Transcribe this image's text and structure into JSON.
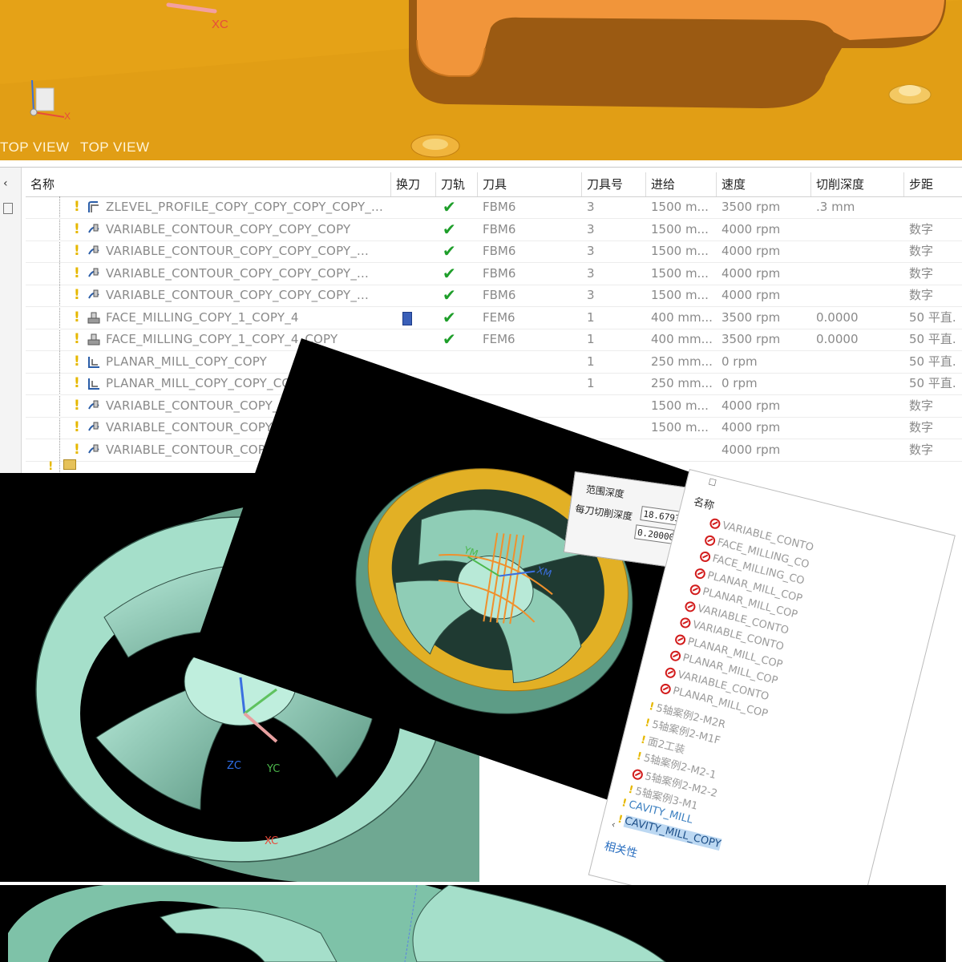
{
  "top_view": {
    "view_labels": [
      "TOP VIEW",
      "TOP VIEW"
    ],
    "axis_xc": "XC",
    "axis_x": "X"
  },
  "operation_table": {
    "columns": [
      "名称",
      "换刀",
      "刀轨",
      "刀具",
      "刀具号",
      "进给",
      "速度",
      "切削深度",
      "步距"
    ],
    "rows": [
      {
        "name": "ZLEVEL_PROFILE_COPY_COPY_COPY_COPY_...",
        "icon": "zlevel-profile-icon",
        "toolchange": false,
        "path_ok": true,
        "tool": "FBM6",
        "tool_no": "3",
        "feed": "1500 m...",
        "speed": "3500 rpm",
        "depth": ".3 mm",
        "step": ""
      },
      {
        "name": "VARIABLE_CONTOUR_COPY_COPY_COPY",
        "icon": "variable-contour-icon",
        "toolchange": false,
        "path_ok": true,
        "tool": "FBM6",
        "tool_no": "3",
        "feed": "1500 m...",
        "speed": "4000 rpm",
        "depth": "",
        "step": "数字"
      },
      {
        "name": "VARIABLE_CONTOUR_COPY_COPY_COPY_...",
        "icon": "variable-contour-icon",
        "toolchange": false,
        "path_ok": true,
        "tool": "FBM6",
        "tool_no": "3",
        "feed": "1500 m...",
        "speed": "4000 rpm",
        "depth": "",
        "step": "数字"
      },
      {
        "name": "VARIABLE_CONTOUR_COPY_COPY_COPY_...",
        "icon": "variable-contour-icon",
        "toolchange": false,
        "path_ok": true,
        "tool": "FBM6",
        "tool_no": "3",
        "feed": "1500 m...",
        "speed": "4000 rpm",
        "depth": "",
        "step": "数字"
      },
      {
        "name": "VARIABLE_CONTOUR_COPY_COPY_COPY_...",
        "icon": "variable-contour-icon",
        "toolchange": false,
        "path_ok": true,
        "tool": "FBM6",
        "tool_no": "3",
        "feed": "1500 m...",
        "speed": "4000 rpm",
        "depth": "",
        "step": "数字"
      },
      {
        "name": "FACE_MILLING_COPY_1_COPY_4",
        "icon": "face-milling-icon",
        "toolchange": true,
        "path_ok": true,
        "tool": "FEM6",
        "tool_no": "1",
        "feed": "400 mm...",
        "speed": "3500 rpm",
        "depth": "0.0000",
        "step": "50 平直."
      },
      {
        "name": "FACE_MILLING_COPY_1_COPY_4_COPY",
        "icon": "face-milling-icon",
        "toolchange": false,
        "path_ok": true,
        "tool": "FEM6",
        "tool_no": "1",
        "feed": "400 mm...",
        "speed": "3500 rpm",
        "depth": "0.0000",
        "step": "50 平直."
      },
      {
        "name": "PLANAR_MILL_COPY_COPY",
        "icon": "planar-mill-icon",
        "toolchange": false,
        "path_ok": false,
        "tool": "",
        "tool_no": "1",
        "feed": "250 mm...",
        "speed": "0 rpm",
        "depth": "",
        "step": "50 平直."
      },
      {
        "name": "PLANAR_MILL_COPY_COPY_COPY",
        "icon": "planar-mill-icon",
        "toolchange": false,
        "path_ok": false,
        "tool": "",
        "tool_no": "1",
        "feed": "250 mm...",
        "speed": "0 rpm",
        "depth": "",
        "step": "50 平直."
      },
      {
        "name": "VARIABLE_CONTOUR_COPY_COPY_COPY_...",
        "icon": "variable-contour-icon",
        "toolchange": true,
        "path_ok": false,
        "tool": "",
        "tool_no": "",
        "feed": "1500 m...",
        "speed": "4000 rpm",
        "depth": "",
        "step": "数字"
      },
      {
        "name": "VARIABLE_CONTOUR_COPY_COPY_COPY_...",
        "icon": "variable-contour-icon",
        "toolchange": false,
        "path_ok": false,
        "tool": "",
        "tool_no": "",
        "feed": "1500 m...",
        "speed": "4000 rpm",
        "depth": "",
        "step": "数字"
      },
      {
        "name": "VARIABLE_CONTOUR_COPY_COPY_COPY_...",
        "icon": "variable-contour-icon",
        "toolchange": false,
        "path_ok": false,
        "tool": "",
        "tool_no": "",
        "feed": "",
        "speed": "4000 rpm",
        "depth": "",
        "step": "数字"
      }
    ]
  },
  "viewport_a": {
    "axis_zc": "ZC",
    "axis_yc": "YC",
    "axis_xc": "XC"
  },
  "viewport_b": {
    "axis_ym": "YM",
    "axis_xm": "XM"
  },
  "depth_popup": {
    "range_label": "范围深度",
    "cut_label": "每刀切削深度",
    "range_value": "18.67938(",
    "cut_value": "0.200000("
  },
  "nav_tree": {
    "header": "名称",
    "footer": "相关性",
    "items": [
      {
        "label": "VARIABLE_CONTO",
        "blocked": true
      },
      {
        "label": "FACE_MILLING_CO",
        "blocked": true
      },
      {
        "label": "FACE_MILLING_CO",
        "blocked": true
      },
      {
        "label": "PLANAR_MILL_COP",
        "blocked": true
      },
      {
        "label": "PLANAR_MILL_COP",
        "blocked": true
      },
      {
        "label": "VARIABLE_CONTO",
        "blocked": true
      },
      {
        "label": "VARIABLE_CONTO",
        "blocked": true
      },
      {
        "label": "PLANAR_MILL_COP",
        "blocked": true
      },
      {
        "label": "PLANAR_MILL_COP",
        "blocked": true
      },
      {
        "label": "VARIABLE_CONTO",
        "blocked": true
      },
      {
        "label": "PLANAR_MILL_COP",
        "blocked": true
      },
      {
        "label": "5轴案例2-M2R",
        "blocked": false
      },
      {
        "label": "5轴案例2-M1F",
        "blocked": false
      },
      {
        "label": "面2工装",
        "blocked": false
      },
      {
        "label": "5轴案例2-M2-1",
        "blocked": false
      },
      {
        "label": "5轴案例2-M2-2",
        "blocked": true
      },
      {
        "label": "5轴案例3-M1",
        "blocked": false
      },
      {
        "label": "CAVITY_MILL",
        "blocked": false
      },
      {
        "label": "CAVITY_MILL_COPY",
        "blocked": false
      }
    ]
  },
  "colors": {
    "part_orange": "#e39a1a",
    "model_green": "#a5e0cc",
    "check_green": "#1e9e2a",
    "blocked_red": "#d21c1c"
  }
}
